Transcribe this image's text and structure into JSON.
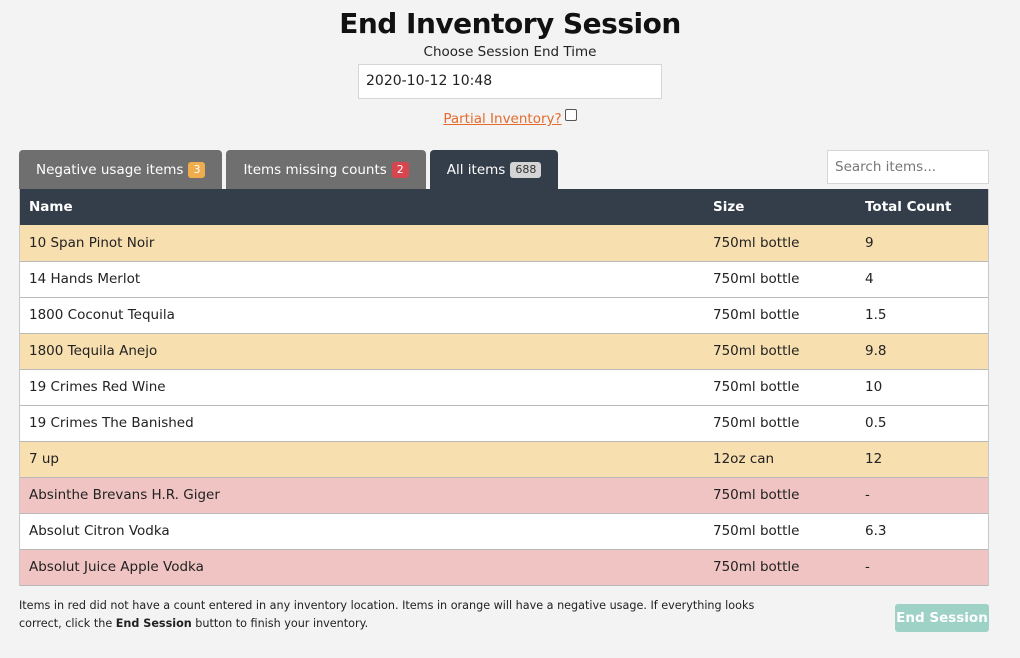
{
  "header": {
    "title": "End Inventory Session",
    "subtitle": "Choose Session End Time",
    "end_time_value": "2020-10-12 10:48",
    "partial_label": "Partial Inventory?"
  },
  "tabs": [
    {
      "label": "Negative usage items",
      "count": "3",
      "badge_color": "#f0ad4e"
    },
    {
      "label": "Items missing counts",
      "count": "2",
      "badge_color": "#d9454f"
    },
    {
      "label": "All items",
      "count": "688",
      "active": true
    }
  ],
  "search": {
    "placeholder": "Search items..."
  },
  "table": {
    "columns": [
      "Name",
      "Size",
      "Total Count"
    ],
    "rows": [
      {
        "name": "10 Span Pinot Noir",
        "size": "750ml bottle",
        "count": "9",
        "status": "orange"
      },
      {
        "name": "14 Hands Merlot",
        "size": "750ml bottle",
        "count": "4",
        "status": "normal"
      },
      {
        "name": "1800 Coconut Tequila",
        "size": "750ml bottle",
        "count": "1.5",
        "status": "normal"
      },
      {
        "name": "1800 Tequila Anejo",
        "size": "750ml bottle",
        "count": "9.8",
        "status": "orange"
      },
      {
        "name": "19 Crimes Red Wine",
        "size": "750ml bottle",
        "count": "10",
        "status": "normal"
      },
      {
        "name": "19 Crimes The Banished",
        "size": "750ml bottle",
        "count": "0.5",
        "status": "normal"
      },
      {
        "name": "7 up",
        "size": "12oz can",
        "count": "12",
        "status": "orange"
      },
      {
        "name": "Absinthe Brevans H.R. Giger",
        "size": "750ml bottle",
        "count": "-",
        "status": "red"
      },
      {
        "name": "Absolut Citron Vodka",
        "size": "750ml bottle",
        "count": "6.3",
        "status": "normal"
      },
      {
        "name": "Absolut Juice Apple Vodka",
        "size": "750ml bottle",
        "count": "-",
        "status": "red"
      },
      {
        "name": "",
        "size": "",
        "count": "",
        "status": "normal"
      }
    ]
  },
  "footer": {
    "note_part1": "Items in red did not have a count entered in any inventory location. Items in orange will have a negative usage. If everything looks correct, click the ",
    "note_bold": "End Session",
    "note_part2": " button to finish your inventory.",
    "end_button": "End Session"
  },
  "colors": {
    "dark_header": "#343e4b",
    "orange_row": "#f8dfb0",
    "red_row": "#efc4c3",
    "end_button": "#9ed2c6",
    "link": "#e36b2c"
  }
}
